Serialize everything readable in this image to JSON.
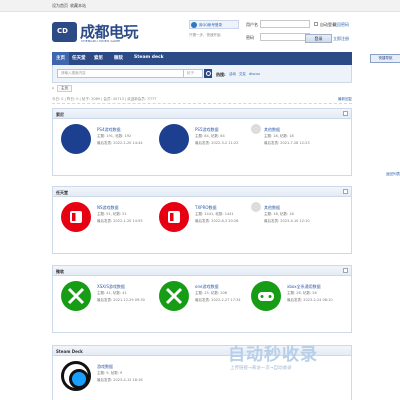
{
  "topbar": {
    "set_home": "设为首页",
    "favorite": "收藏本站"
  },
  "logo": {
    "badge": "CD",
    "title": "成都电玩",
    "subtitle": "CHENGDU VIDEO GAME"
  },
  "login": {
    "qq_label": "用QQ帐号登录",
    "qq_tip": "只需一步，快速开始",
    "username_label": "用户名",
    "username_placeholder": "",
    "password_label": "密码",
    "auto_login": "自动登录",
    "forgot": "找回密码",
    "submit": "登录",
    "register": "立即注册"
  },
  "nav": {
    "items": [
      "主页",
      "任天堂",
      "索尼",
      "微软",
      "Steam deck"
    ],
    "quick": "快捷导航"
  },
  "search": {
    "placeholder": "请输入搜索内容",
    "scope": "帖子",
    "hot_label": "热搜:",
    "hot_items": [
      "活动",
      "交友",
      "discuz"
    ]
  },
  "breadcrumb": {
    "tab": "主页"
  },
  "stats": {
    "text": "今日: 0 | 昨日: 0 | 帖子: 2089 | 会员: 45713 | 欢迎新会员: ?????",
    "latest": "最新回复"
  },
  "sections": [
    {
      "title": "索尼",
      "forums": [
        {
          "name": "PS4游戏数据",
          "meta1": "主题: 191, 帖数: 192",
          "meta2": "最后发表: 2022-1-20 14:44",
          "icon": "playstation-icon"
        },
        {
          "name": "PS5游戏数据",
          "meta1": "主题: 84, 帖数: 84",
          "meta2": "最后发表: 2022-3-2 11:22",
          "icon": "playstation-icon"
        },
        {
          "name": "其他数据",
          "meta1": "主题: 18, 帖数: 18",
          "meta2": "最后发表: 2021-7-28 12:23",
          "icon": "default-forum-icon"
        }
      ]
    },
    {
      "title": "任天堂",
      "forums": [
        {
          "name": "NS游戏数据",
          "meta1": "主题: 51, 帖数: 51",
          "meta2": "最后发表: 2022-1-20 14:55",
          "icon": "nintendo-switch-icon"
        },
        {
          "name": "TXPRO数据",
          "meta1": "主题: 1441, 帖数: 1441",
          "meta2": "最后发表: 2022-8-3 20:26",
          "icon": "nintendo-switch-icon"
        },
        {
          "name": "其他数据",
          "meta1": "主题: 16, 帖数: 16",
          "meta2": "最后发表: 2023-4-10 12:10",
          "icon": "default-forum-icon"
        }
      ]
    },
    {
      "title": "微软",
      "forums": [
        {
          "name": "XSX/S游戏数据",
          "meta1": "主题: 41, 帖数: 41",
          "meta2": "最后发表: 2021-12-29 09:30",
          "icon": "xbox-icon"
        },
        {
          "name": "one游戏数据",
          "meta1": "主题: 25, 帖数: 206",
          "meta2": "最后发表: 2022-2-27 17:34",
          "icon": "xbox-icon"
        },
        {
          "name": "xbox全系通用数据",
          "meta1": "主题: 26, 帖数: 26",
          "meta2": "最后发表: 2023-2-24 08:10",
          "icon": "gamepad-icon"
        }
      ]
    },
    {
      "title": "Steam Deck",
      "forums": [
        {
          "name": "游戏数据",
          "meta1": "主题: 9, 帖数: 9",
          "meta2": "最后发表: 2023-4-12 18:16",
          "icon": "steam-deck-icon"
        }
      ]
    }
  ],
  "side_link": "返回列表",
  "watermark": {
    "big": "自动秒收录",
    "small": "上传链接→来访一次→自动收录"
  },
  "colors": {
    "brand": "#2b4a86",
    "link": "#2b5ca8",
    "ps": "#1d3f8f",
    "ns": "#e60012",
    "xbox": "#179c16"
  }
}
